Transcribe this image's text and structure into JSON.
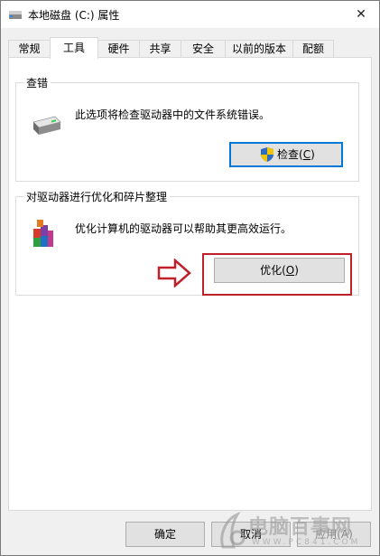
{
  "window": {
    "title": "本地磁盘 (C:) 属性",
    "close_glyph": "✕"
  },
  "tabs": [
    {
      "label": "常规",
      "active": false
    },
    {
      "label": "工具",
      "active": true
    },
    {
      "label": "硬件",
      "active": false
    },
    {
      "label": "共享",
      "active": false
    },
    {
      "label": "安全",
      "active": false
    },
    {
      "label": "以前的版本",
      "active": false
    },
    {
      "label": "配额",
      "active": false
    }
  ],
  "check_group": {
    "title": "查错",
    "description": "此选项将检查驱动器中的文件系统错误。",
    "button_text": "检查(",
    "button_hotkey": "C",
    "button_suffix": ")"
  },
  "optimize_group": {
    "title": "对驱动器进行优化和碎片整理",
    "description": "优化计算机的驱动器可以帮助其更高效运行。",
    "button_text": "优化(",
    "button_hotkey": "O",
    "button_suffix": ")"
  },
  "footer": {
    "ok_label": "确定",
    "cancel_label": "取消",
    "apply_label": "应用(A)"
  },
  "watermark": {
    "text": "电脑百事网",
    "sub": "WWW.PC841.COM"
  },
  "colors": {
    "highlight_red": "#c0202a",
    "focus_blue": "#0078d7"
  }
}
